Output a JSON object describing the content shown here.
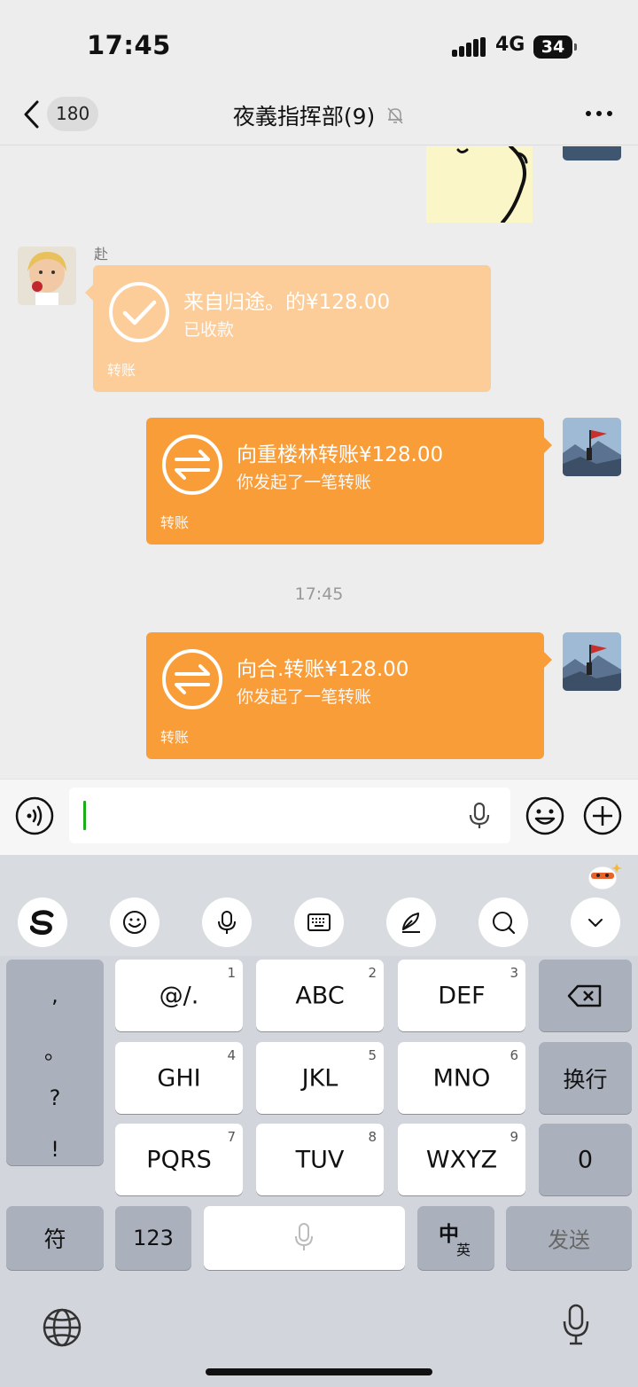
{
  "status_bar": {
    "time": "17:45",
    "network": "4G",
    "battery": "34"
  },
  "nav": {
    "back_count": "180",
    "title": "夜義指挥部(9)"
  },
  "chat": {
    "messages": [
      {
        "sender": "赴",
        "title": "来自归途。的¥128.00",
        "subtitle": "已收款",
        "footer": "转账"
      },
      {
        "title": "向重楼林转账¥128.00",
        "subtitle": "你发起了一笔转账",
        "footer": "转账"
      },
      {
        "title": "向合.转账¥128.00",
        "subtitle": "你发起了一笔转账",
        "footer": "转账"
      }
    ],
    "timestamp": "17:45"
  },
  "keyboard": {
    "punct": [
      ",",
      "。",
      "?",
      "!"
    ],
    "keys": [
      {
        "label": "@/.",
        "num": "1"
      },
      {
        "label": "ABC",
        "num": "2"
      },
      {
        "label": "DEF",
        "num": "3"
      },
      {
        "label": "GHI",
        "num": "4"
      },
      {
        "label": "JKL",
        "num": "5"
      },
      {
        "label": "MNO",
        "num": "6"
      },
      {
        "label": "PQRS",
        "num": "7"
      },
      {
        "label": "TUV",
        "num": "8"
      },
      {
        "label": "WXYZ",
        "num": "9"
      }
    ],
    "return_label": "换行",
    "zero_label": "0",
    "symbol_label": "符",
    "num_label": "123",
    "lang_main": "中",
    "lang_sub": "英",
    "send_label": "发送"
  },
  "colors": {
    "received_bubble": "#fccc99",
    "sent_bubble": "#f99d38",
    "cursor": "#1aad19"
  }
}
